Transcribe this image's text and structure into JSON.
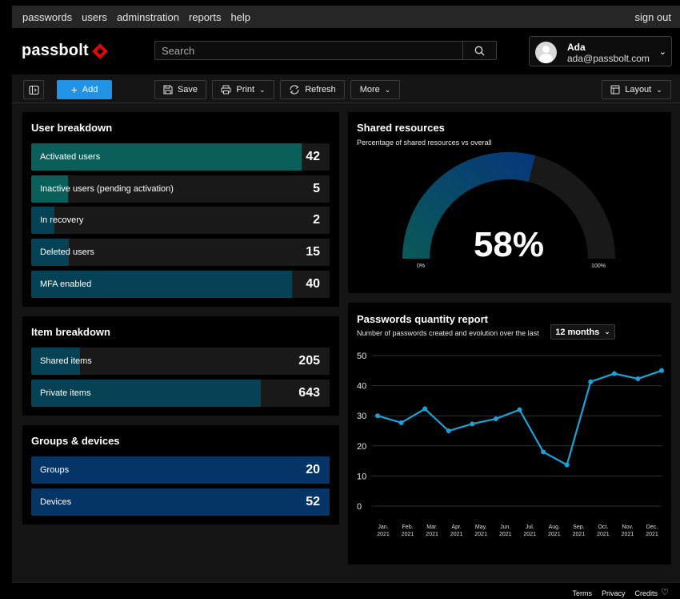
{
  "topnav": {
    "links": [
      "passwords",
      "users",
      "adminstration",
      "reports",
      "help"
    ],
    "sign_out": "sign out"
  },
  "header": {
    "logo_text": "passbolt",
    "search_placeholder": "Search",
    "user": {
      "name": "Ada",
      "email": "ada@passbolt.com"
    }
  },
  "toolbar": {
    "add": "Add",
    "save": "Save",
    "print": "Print",
    "refresh": "Refresh",
    "more": "More",
    "layout": "Layout"
  },
  "user_breakdown": {
    "title": "User breakdown",
    "rows": [
      {
        "label": "Activated users",
        "value": "42",
        "fill": 0.905,
        "color": "#0b5f5a"
      },
      {
        "label": "Inactive users (pending activation)",
        "value": "5",
        "fill": 0.123,
        "color": "#0b5f5a"
      },
      {
        "label": "In recovery",
        "value": "2",
        "fill": 0.078,
        "color": "#064256"
      },
      {
        "label": "Deleted users",
        "value": "15",
        "fill": 0.126,
        "color": "#064256"
      },
      {
        "label": "MFA enabled",
        "value": "40",
        "fill": 0.874,
        "color": "#064256"
      }
    ]
  },
  "item_breakdown": {
    "title": "Item breakdown",
    "rows": [
      {
        "label": "Shared items",
        "value": "205",
        "fill": 0.164,
        "color": "#064256"
      },
      {
        "label": "Private items",
        "value": "643",
        "fill": 0.77,
        "color": "#064256"
      }
    ]
  },
  "groups_devices": {
    "title": "Groups & devices",
    "rows": [
      {
        "label": "Groups",
        "value": "20",
        "fill": 1.0,
        "color": "#053566"
      },
      {
        "label": "Devices",
        "value": "52",
        "fill": 1.0,
        "color": "#053566"
      }
    ]
  },
  "shared_resources": {
    "title": "Shared resources",
    "subtitle": "Percentage of shared resources vs overall",
    "percent": 58,
    "percent_text": "58%",
    "min_label": "0%",
    "max_label": "100%"
  },
  "passwords_report": {
    "title": "Passwords quantity report",
    "subtitle": "Number of passwords created and evolution over the last",
    "period": "12 months"
  },
  "chart_data": {
    "type": "line",
    "title": "Passwords quantity report",
    "x": [
      "Jan. 2021",
      "Feb. 2021",
      "Mar. 2021",
      "Apr. 2021",
      "May. 2021",
      "Jun. 2021",
      "Jul. 2021",
      "Aug. 2021",
      "Sep. 2021",
      "Oct. 2021",
      "Nov. 2021",
      "Dec. 2021"
    ],
    "tick_labels": [
      [
        "Jan.",
        "2021"
      ],
      [
        "Feb.",
        "2021"
      ],
      [
        "Mar.",
        "2021"
      ],
      [
        "Apr.",
        "2021"
      ],
      [
        "May.",
        "2021"
      ],
      [
        "Jun.",
        "2021"
      ],
      [
        "Jul.",
        "2021"
      ],
      [
        "Aug.",
        "2021"
      ],
      [
        "Sep.",
        "2021"
      ],
      [
        "Oct.",
        "2021"
      ],
      [
        "Nov.",
        "2021"
      ],
      [
        "Dec.",
        "2021"
      ]
    ],
    "values": [
      30,
      27.7,
      32.3,
      25,
      27.3,
      29,
      32,
      18,
      13.7,
      41.3,
      44,
      42.3,
      45
    ],
    "y_ticks": [
      0,
      10,
      20,
      30,
      40,
      50
    ],
    "ylim": [
      0,
      50
    ],
    "grid": true,
    "line_color": "#1aa3d9"
  }
}
